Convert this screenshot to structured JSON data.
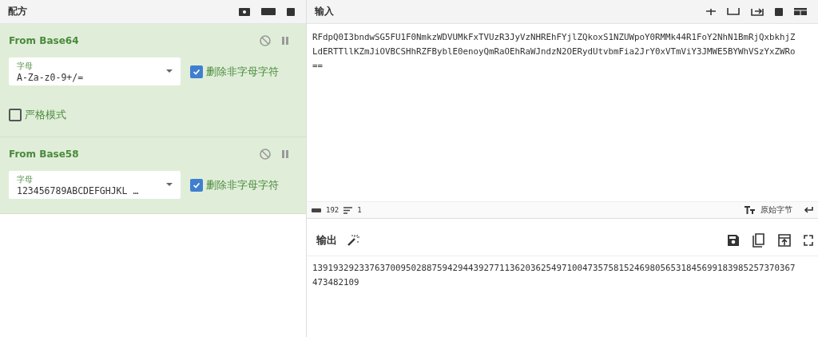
{
  "recipe": {
    "title": "配方",
    "operations": [
      {
        "name": "From Base64",
        "field": {
          "label": "字母",
          "value": "A-Za-z0-9+/="
        },
        "options": [
          {
            "kind": "checkbox",
            "label": "删除非字母字符",
            "checked": true
          },
          {
            "kind": "checkbox",
            "label": "严格模式",
            "checked": false
          }
        ]
      },
      {
        "name": "From Base58",
        "field": {
          "label": "字母",
          "value": "123456789ABCDEFGHJKL …"
        },
        "options": [
          {
            "kind": "checkbox",
            "label": "删除非字母字符",
            "checked": true
          }
        ]
      }
    ]
  },
  "input": {
    "title": "输入",
    "lines": [
      "RFdpQ0I3bndwSG5FU1F0NmkzWDVUMkFxTVUzR3JyVzNHREhFYjlZQkoxS1NZUWpoY0RMMk44R1FoY2NhN1BmRjQxbkhjZ",
      "LdERTTllKZmJiOVBCSHhRZFByblE0enoyQmRaOEhRaWJndzN2OERydUtvbmFia2JrY0xVTmViY3JMWE5BYWhVSzYxZWRo",
      "=="
    ]
  },
  "status": {
    "length": "192",
    "lines": "1",
    "encoding": "原始字节"
  },
  "output": {
    "title": "输出",
    "lines": [
      "139193292337637009502887594294439277113620362549710047357581524698056531845699183985257370367",
      "473482109"
    ]
  }
}
